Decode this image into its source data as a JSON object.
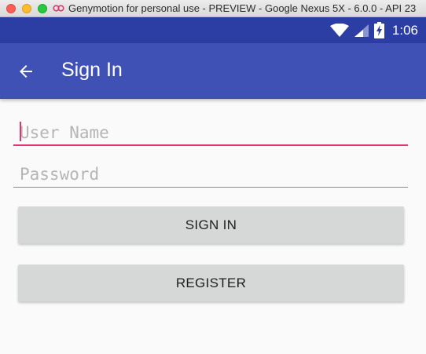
{
  "window": {
    "title": "Genymotion for personal use - PREVIEW - Google Nexus 5X - 6.0.0 - API 23"
  },
  "status_bar": {
    "time": "1:06",
    "icons": [
      "wifi-icon",
      "cell-signal-icon",
      "battery-charging-icon"
    ]
  },
  "app_bar": {
    "title": "Sign In",
    "nav_icon": "arrow-back-icon"
  },
  "form": {
    "username": {
      "value": "",
      "placeholder": "User Name"
    },
    "password": {
      "value": "",
      "placeholder": "Password"
    },
    "sign_in_label": "SIGN IN",
    "register_label": "REGISTER"
  },
  "colors": {
    "status_bar": "#2c3ea4",
    "app_bar": "#3f51b5",
    "accent": "#e4316f",
    "button": "#d6d7d7",
    "background": "#fafafa"
  }
}
